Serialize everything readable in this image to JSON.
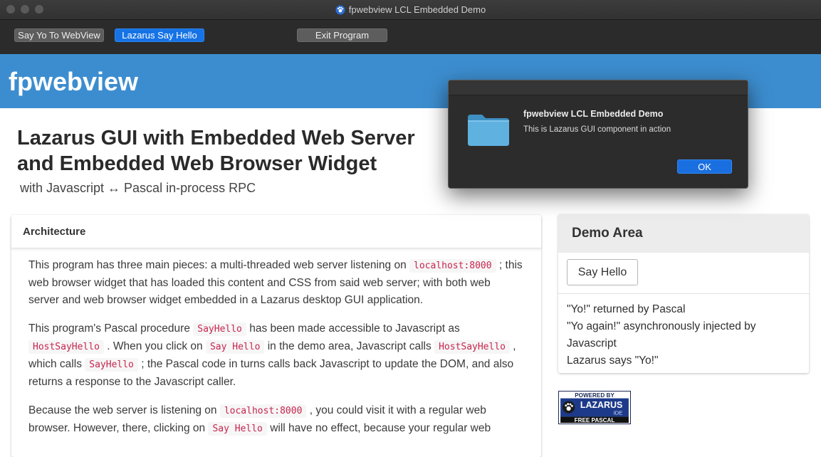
{
  "window": {
    "title": "fpwebview LCL Embedded Demo"
  },
  "toolbar": {
    "say_yo_label": "Say Yo To WebView",
    "lazarus_hello_label": "Lazarus Say Hello",
    "exit_label": "Exit Program"
  },
  "page": {
    "brand": "fpwebview",
    "heading_line1": "Lazarus GUI with Embedded Web Server",
    "heading_line2": "and Embedded Web Browser Widget",
    "subtitle": "with Javascript ↔ Pascal in-process RPC"
  },
  "architecture": {
    "title": "Architecture",
    "p1": {
      "a": "This program has three main pieces: a multi-threaded web server listening on",
      "code1": "localhost:8000",
      "b": "; this web browser widget that has loaded this content and CSS from said web server; with both web server and web browser widget embedded in a Lazarus desktop GUI application."
    },
    "p2": {
      "a": "This program's Pascal procedure",
      "code1": "SayHello",
      "b": "has been made accessible to Javascript as",
      "code2": "HostSayHello",
      "c": ". When you click on",
      "code3": "Say Hello",
      "d": "in the demo area, Javascript calls",
      "code4": "HostSayHello",
      "e": ", which calls",
      "code5": "SayHello",
      "f": "; the Pascal code in turns calls back Javascript to update the DOM, and also returns a response to the Javascript caller."
    },
    "p3": {
      "a": "Because the web server is listening on",
      "code1": "localhost:8000",
      "b": ", you could visit it with a regular web browser. However, there, clicking on",
      "code2": "Say Hello",
      "c": "will have no effect, because your regular web"
    }
  },
  "demo": {
    "title": "Demo Area",
    "button_label": "Say Hello",
    "output": [
      "\"Yo!\" returned by Pascal",
      "\"Yo again!\" asynchronously injected by",
      "Javascript",
      "Lazarus says \"Yo!\""
    ]
  },
  "logo": {
    "top": "POWERED BY",
    "name": "LAZARUS",
    "ide": "IDE",
    "bottom": "FREE PASCAL"
  },
  "dialog": {
    "title": "fpwebview LCL Embedded Demo",
    "message": "This is Lazarus GUI component in action",
    "ok_label": "OK"
  },
  "colors": {
    "header_blue": "#3c8dcf",
    "code_red": "#c7254e",
    "accent_blue": "#1673e6"
  }
}
